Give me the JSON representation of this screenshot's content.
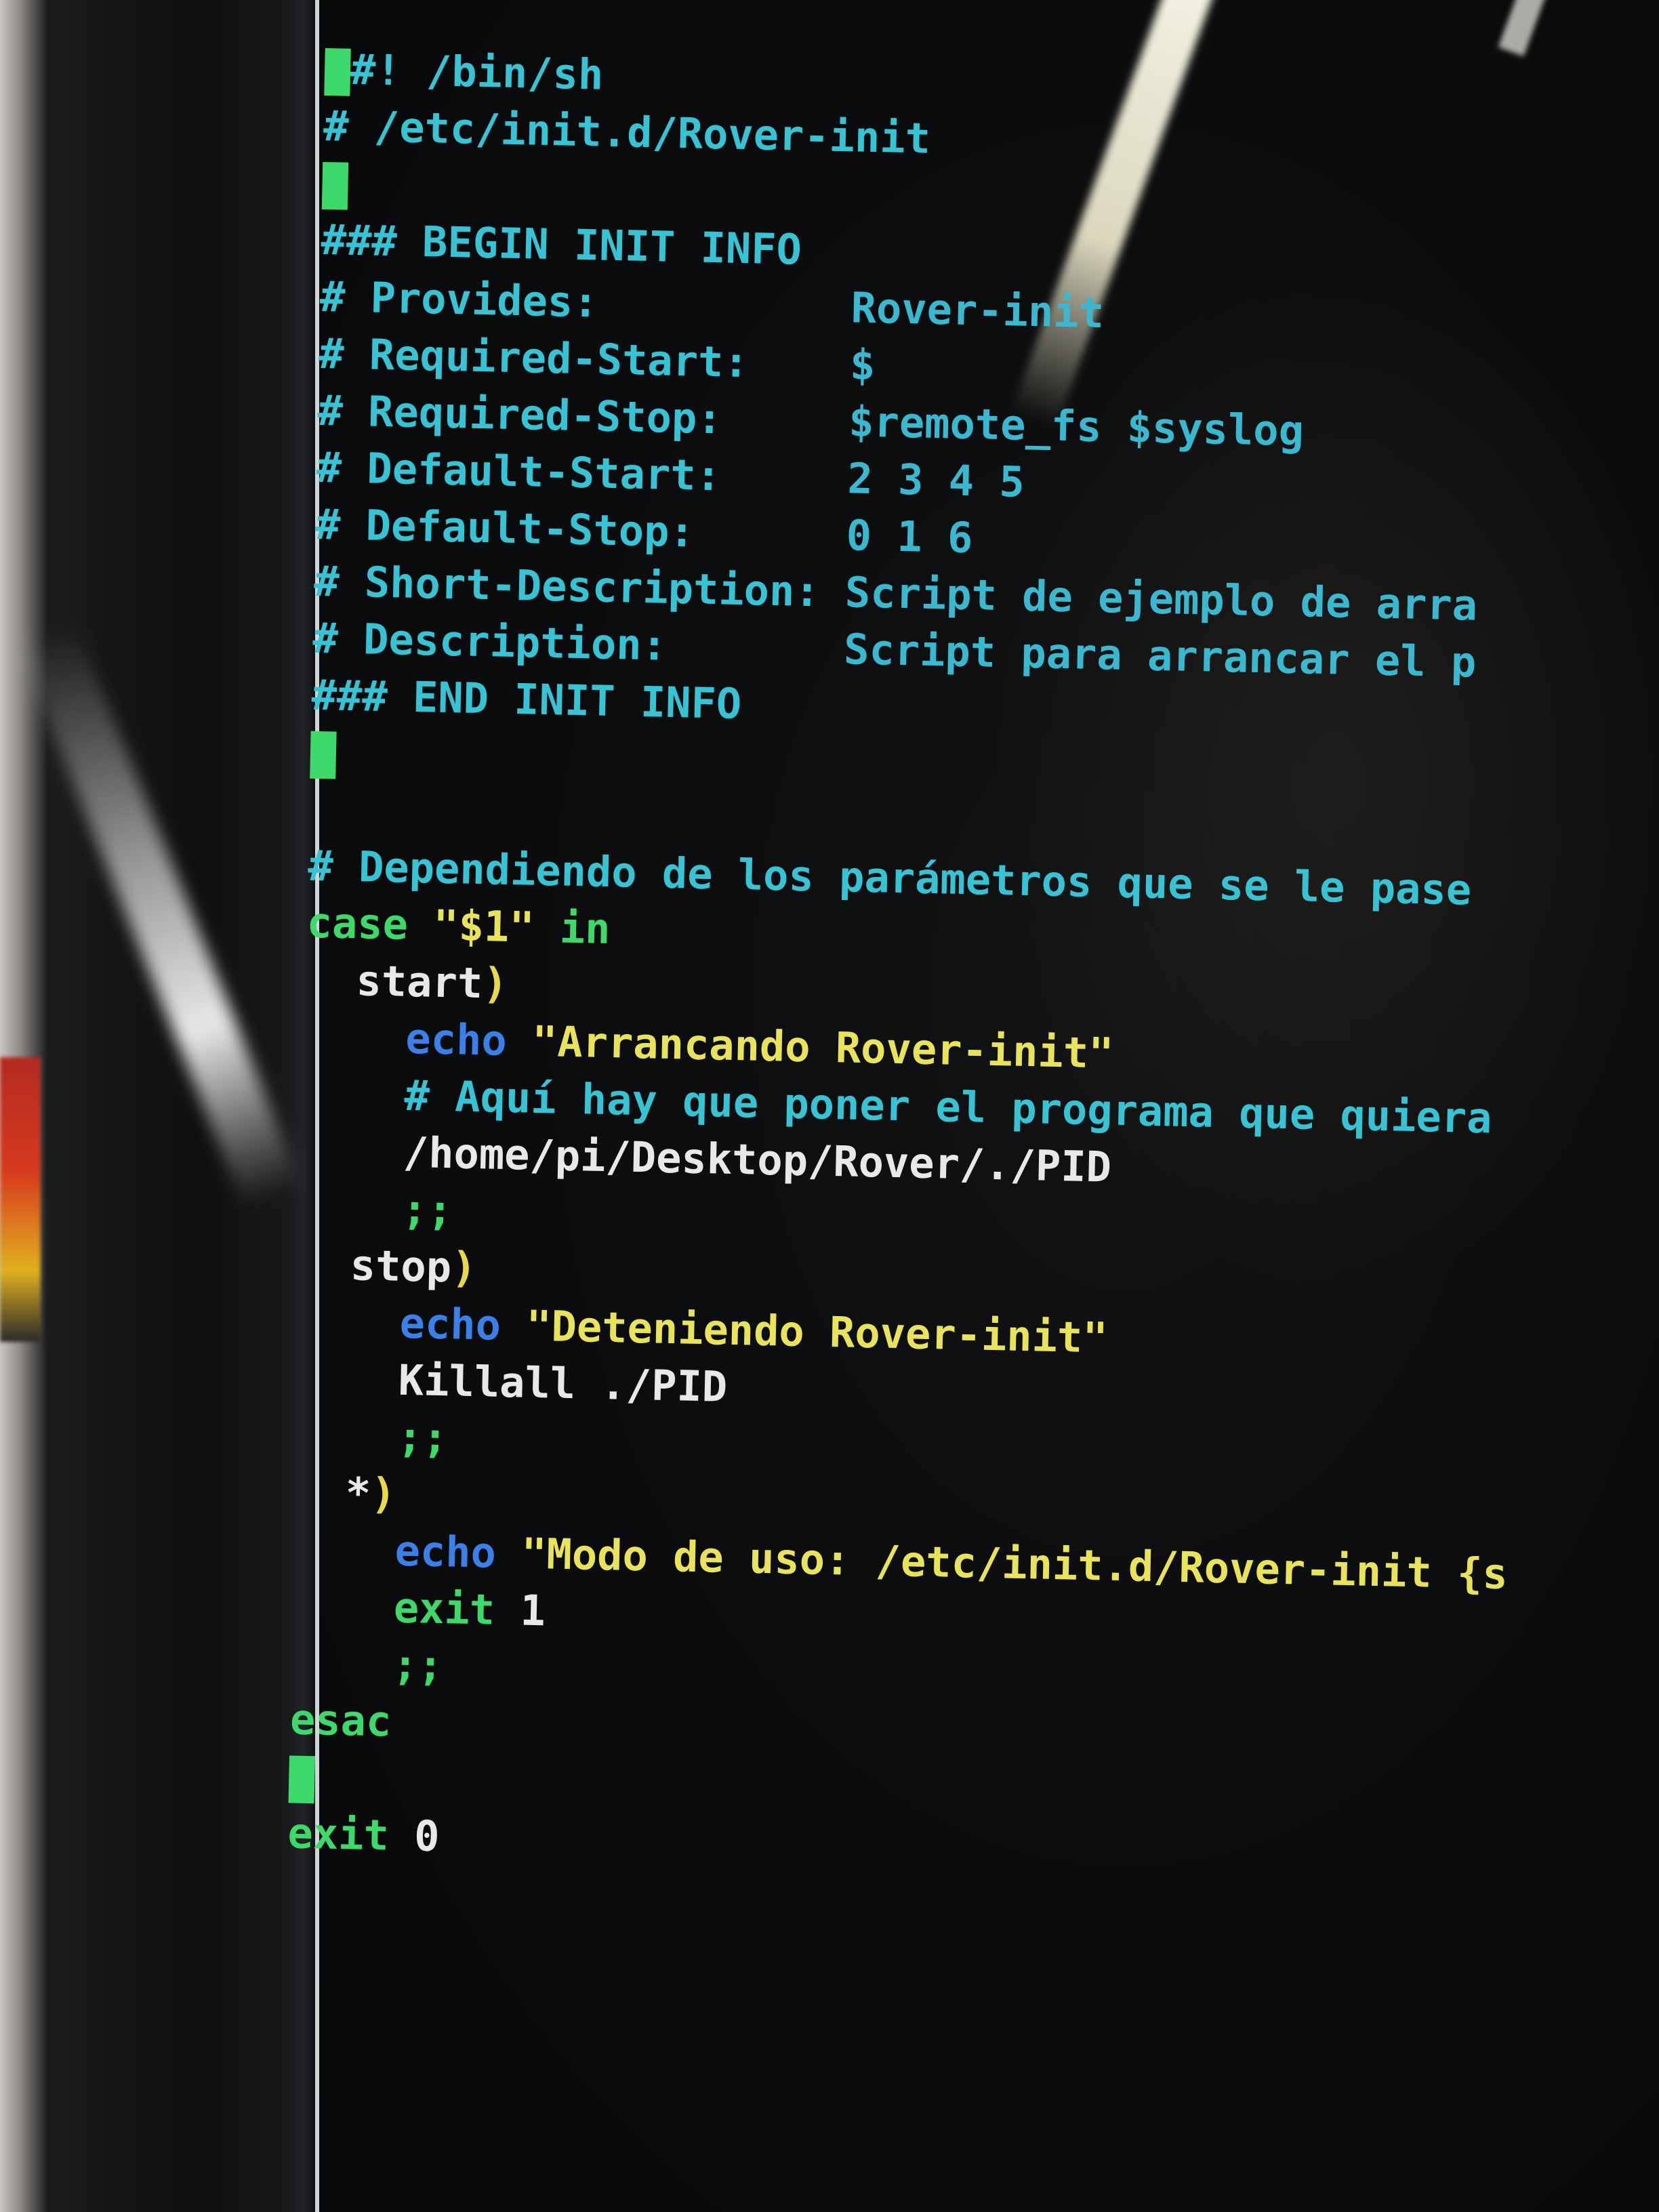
{
  "terminal": {
    "lines": [
      {
        "indent": "",
        "parts": [
          {
            "t": "#! /bin/sh",
            "c": "c-comment"
          }
        ],
        "cursor": true
      },
      {
        "indent": "",
        "parts": [
          {
            "t": "# /etc/init.d/Rover-init",
            "c": "c-comment"
          }
        ]
      },
      {
        "indent": "",
        "parts": [],
        "cursor": true
      },
      {
        "indent": "",
        "parts": [
          {
            "t": "### BEGIN INIT INFO",
            "c": "c-comment"
          }
        ]
      },
      {
        "indent": "",
        "parts": [
          {
            "t": "# Provides:          ",
            "c": "c-comment"
          },
          {
            "t": "Rover-init",
            "c": "c-key"
          }
        ]
      },
      {
        "indent": "",
        "parts": [
          {
            "t": "# Required-Start:    ",
            "c": "c-comment"
          },
          {
            "t": "$",
            "c": "c-key"
          }
        ]
      },
      {
        "indent": "",
        "parts": [
          {
            "t": "# Required-Stop:     ",
            "c": "c-comment"
          },
          {
            "t": "$remote_fs $syslog",
            "c": "c-key"
          }
        ]
      },
      {
        "indent": "",
        "parts": [
          {
            "t": "# Default-Start:     ",
            "c": "c-comment"
          },
          {
            "t": "2 3 4 5",
            "c": "c-key"
          }
        ]
      },
      {
        "indent": "",
        "parts": [
          {
            "t": "# Default-Stop:      ",
            "c": "c-comment"
          },
          {
            "t": "0 1 6",
            "c": "c-key"
          }
        ]
      },
      {
        "indent": "",
        "parts": [
          {
            "t": "# Short-Description: ",
            "c": "c-comment"
          },
          {
            "t": "Script de ejemplo de arra",
            "c": "c-key"
          }
        ]
      },
      {
        "indent": "",
        "parts": [
          {
            "t": "# Description:       ",
            "c": "c-comment"
          },
          {
            "t": "Script para arrancar el p",
            "c": "c-key"
          }
        ]
      },
      {
        "indent": "",
        "parts": [
          {
            "t": "### END INIT INFO",
            "c": "c-comment"
          }
        ]
      },
      {
        "indent": "",
        "parts": [],
        "cursor": true
      },
      {
        "indent": "",
        "parts": []
      },
      {
        "indent": "",
        "parts": [
          {
            "t": "# Dependiendo de los parámetros que se le pase",
            "c": "c-comment"
          }
        ]
      },
      {
        "indent": "",
        "parts": [
          {
            "t": "case ",
            "c": "c-kw"
          },
          {
            "t": "\"$1\"",
            "c": "c-str"
          },
          {
            "t": " in",
            "c": "c-kw"
          }
        ]
      },
      {
        "indent": "  ",
        "parts": [
          {
            "t": "start",
            "c": "c-plain"
          },
          {
            "t": ")",
            "c": "c-paren"
          }
        ]
      },
      {
        "indent": "    ",
        "parts": [
          {
            "t": "echo ",
            "c": "c-echo"
          },
          {
            "t": "\"Arrancando Rover-init\"",
            "c": "c-str"
          }
        ]
      },
      {
        "indent": "    ",
        "parts": [
          {
            "t": "# Aquí hay que poner el programa que quiera",
            "c": "c-comment"
          }
        ]
      },
      {
        "indent": "    ",
        "parts": [
          {
            "t": "/home/pi/Desktop/Rover/./PID",
            "c": "c-plain"
          }
        ]
      },
      {
        "indent": "    ",
        "parts": [
          {
            "t": ";;",
            "c": "c-semi"
          }
        ]
      },
      {
        "indent": "  ",
        "parts": [
          {
            "t": "stop",
            "c": "c-plain"
          },
          {
            "t": ")",
            "c": "c-paren"
          }
        ]
      },
      {
        "indent": "    ",
        "parts": [
          {
            "t": "echo ",
            "c": "c-echo"
          },
          {
            "t": "\"Deteniendo Rover-init\"",
            "c": "c-str"
          }
        ]
      },
      {
        "indent": "    ",
        "parts": [
          {
            "t": "Killall ./PID",
            "c": "c-plain"
          }
        ]
      },
      {
        "indent": "    ",
        "parts": [
          {
            "t": ";;",
            "c": "c-semi"
          }
        ]
      },
      {
        "indent": "  ",
        "parts": [
          {
            "t": "*",
            "c": "c-plain"
          },
          {
            "t": ")",
            "c": "c-paren"
          }
        ]
      },
      {
        "indent": "    ",
        "parts": [
          {
            "t": "echo ",
            "c": "c-echo"
          },
          {
            "t": "\"Modo de uso: /etc/init.d/Rover-init {s",
            "c": "c-str"
          }
        ]
      },
      {
        "indent": "    ",
        "parts": [
          {
            "t": "exit ",
            "c": "c-kw"
          },
          {
            "t": "1",
            "c": "c-plain"
          }
        ]
      },
      {
        "indent": "    ",
        "parts": [
          {
            "t": ";;",
            "c": "c-semi"
          }
        ]
      },
      {
        "indent": "",
        "parts": [
          {
            "t": "esac",
            "c": "c-kw"
          }
        ]
      },
      {
        "indent": "",
        "parts": [],
        "cursor": true
      },
      {
        "indent": "",
        "parts": [
          {
            "t": "exit ",
            "c": "c-kw"
          },
          {
            "t": "0",
            "c": "c-plain"
          }
        ]
      }
    ]
  },
  "colors": {
    "comment": "#37c3d3",
    "keyword": "#3fd86b",
    "string": "#e8e35a",
    "echo": "#3b7fe8",
    "plain": "#e8e8e8",
    "background": "#0c0d0e"
  }
}
